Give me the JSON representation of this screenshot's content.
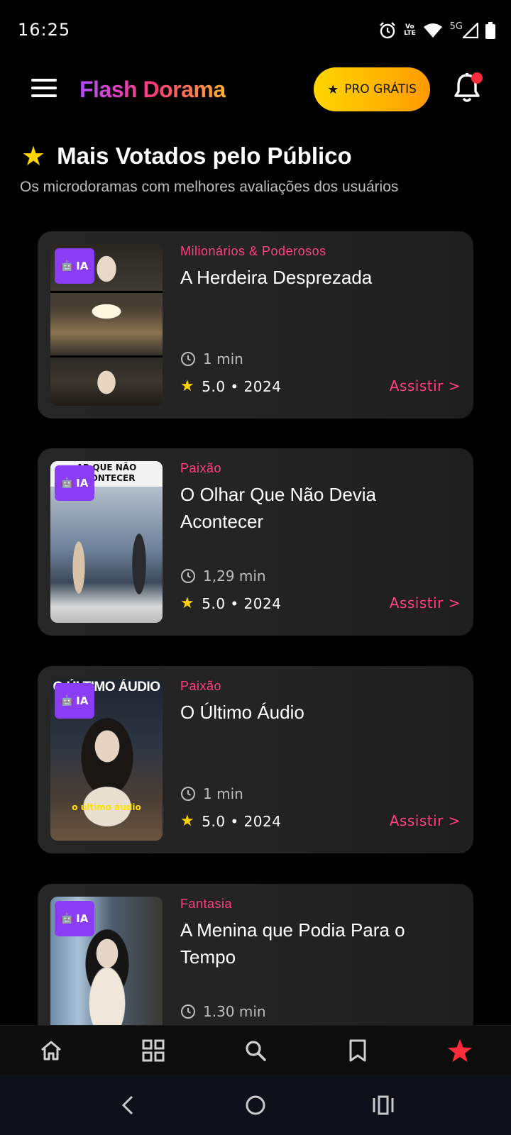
{
  "status_bar": {
    "time": "16:25",
    "network_label": "5G",
    "volte_label_1": "Vo",
    "volte_label_2": "LTE"
  },
  "header": {
    "brand": "Flash Dorama",
    "pro_label": "PRO GRÁTIS",
    "notification_badge_color": "#ff2d3b"
  },
  "section": {
    "title": "Mais Votados pelo Público",
    "subtitle": "Os microdoramas com melhores avaliações dos usuários"
  },
  "ia_badge_label": "IA",
  "cards": [
    {
      "category": "Milionários & Poderosos",
      "title": "A Herdeira Desprezada",
      "duration": "1 min",
      "rating_year": "5.0 • 2024",
      "action": "Assistir >"
    },
    {
      "category": "Paixão",
      "title": "O Olhar Que Não Devia Acontecer",
      "duration": "1,29 min",
      "rating_year": "5.0 • 2024",
      "action": "Assistir >",
      "thumb_caption": "AR QUE NÃO ACONTECER"
    },
    {
      "category": "Paixão",
      "title": "O Último Áudio",
      "duration": "1 min",
      "rating_year": "5.0 • 2024",
      "action": "Assistir >",
      "thumb_caption": "O ÚLTIMO ÁUDIO",
      "thumb_subtitle": "o último áudio"
    },
    {
      "category": "Fantasia",
      "title": "A Menina que Podia Para o Tempo",
      "duration": "1.30 min"
    }
  ],
  "bottom_nav": {
    "items": [
      "home-icon",
      "grid-icon",
      "search-icon",
      "bookmark-icon",
      "star-icon"
    ],
    "active": "star-icon",
    "active_color": "#ff2d3b"
  },
  "colors": {
    "accent_pink": "#ff3f7f",
    "accent_purple": "#8b3df5",
    "pro_yellow": "#ffc400",
    "star_yellow": "#ffd400"
  }
}
